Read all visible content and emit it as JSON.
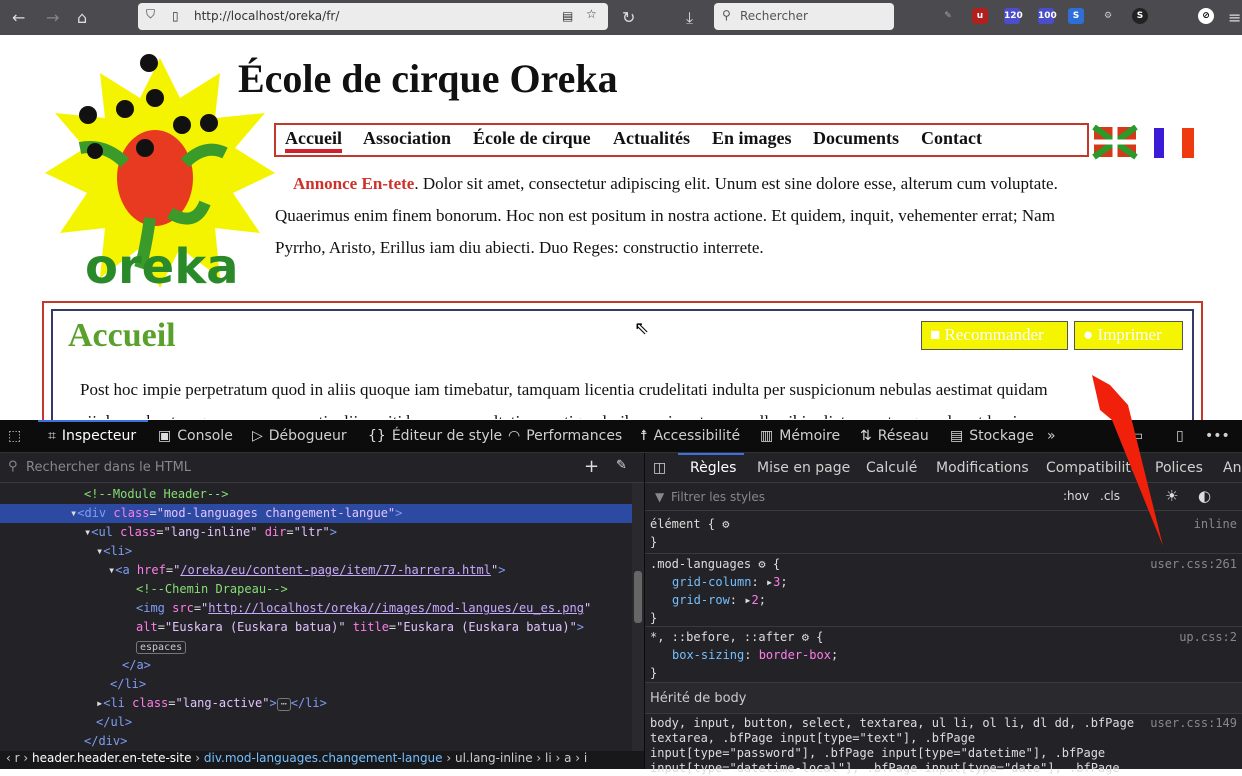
{
  "browser": {
    "url": "http://localhost/oreka/fr/",
    "search_placeholder": "Rechercher",
    "badges": [
      "120",
      "100"
    ]
  },
  "site": {
    "logo_text": "oreka",
    "title": "École de cirque Oreka",
    "nav": [
      "Accueil",
      "Association",
      "École de cirque",
      "Actualités",
      "En images",
      "Documents",
      "Contact"
    ],
    "intro_label": "Annonce En-tete",
    "intro_text": ". Dolor sit amet, consectetur adipiscing elit. Unum est sine dolore esse, alterum cum voluptate. Quaerimus enim finem bonorum. Hoc non est positum in nostra actione. Et quidem, inquit, vehementer errat; Nam Pyrrho, Aristo, Erillus iam diu abiecti. Duo Reges: constructio interrete.",
    "heading": "Accueil",
    "recommend_label": "Recommander",
    "print_label": "Imprimer",
    "body_text": "Post hoc impie perpetratum quod in aliis quoque iam timebatur, tamquam licentia crudelitati indulta per suspicionum nebulas aestimat quidam",
    "body_text2": "noxii damnabantur, quorum pars necati, alii puniti bonorum multatione actique laribus suis extorres nullo sibi relicto praeter querelas et lacrimas"
  },
  "devtools": {
    "tabs": [
      "Inspecteur",
      "Console",
      "Débogueur",
      "Éditeur de style",
      "Performances",
      "Accessibilité",
      "Mémoire",
      "Réseau",
      "Stockage"
    ],
    "html_search_placeholder": "Rechercher dans le HTML",
    "tree": {
      "comment1": "<!--Module Header-->",
      "div_class": "mod-languages changement-langue",
      "ul_class": "lang-inline",
      "ul_dir": "ltr",
      "href": "/oreka/eu/content-page/item/77-harrera.html",
      "comment2": "<!--Chemin Drapeau-->",
      "img_src": "http://localhost/oreka//images/mod-langues/eu_es.png",
      "img_alt": "Euskara (Euskara batua)",
      "img_title": "Euskara (Euskara batua)",
      "badge": "espaces",
      "li_class": "lang-active"
    },
    "breadcrumbs": [
      "header.header.en-tete-site",
      "div.mod-languages.changement-langue",
      "ul.lang-inline",
      "li",
      "a",
      "i"
    ],
    "side_tabs": [
      "Règles",
      "Mise en page",
      "Calculé",
      "Modifications",
      "Compatibilité",
      "Polices",
      "An"
    ],
    "filter_placeholder": "Filtrer les styles",
    "hov": ":hov",
    "cls": ".cls",
    "rules": {
      "r1_sel": "élément {",
      "r1_src": "inline",
      "r2_sel": ".mod-languages",
      "r2_src": "user.css:261",
      "p1": "grid-column",
      "v1": "3",
      "p2": "grid-row",
      "v2": "2",
      "r3_sel": "*, ::before, ::after",
      "r3_src": "up.css:2",
      "p3": "box-sizing",
      "v3": "border-box",
      "inherited": "Hérité de body",
      "r4_src": "user.css:149",
      "r4_lines": [
        "body, input, button, select, textarea, ul li, ol li, dl dd, .bfPage",
        "textarea, .bfPage input[type=\"text\"], .bfPage",
        "input[type=\"password\"], .bfPage input[type=\"datetime\"], .bfPage",
        "input[type=\"datetime-local\"], .bfPage input[type=\"date\"], .bfPage"
      ]
    }
  },
  "colors": {
    "accent_red": "#d0202a",
    "heading_green": "#5aa02c",
    "button_yellow": "#f5f500",
    "selection_blue": "#2d4aa3"
  }
}
